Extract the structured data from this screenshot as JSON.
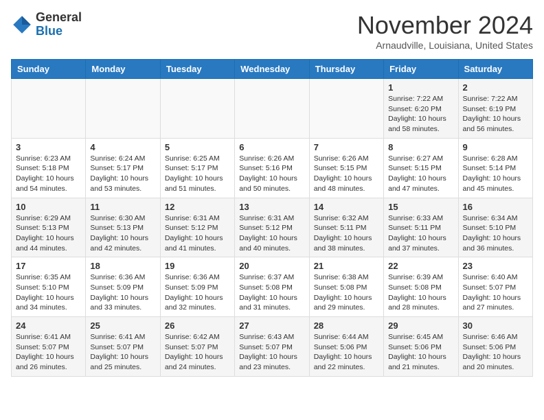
{
  "logo": {
    "general": "General",
    "blue": "Blue"
  },
  "header": {
    "month": "November 2024",
    "location": "Arnaudville, Louisiana, United States"
  },
  "weekdays": [
    "Sunday",
    "Monday",
    "Tuesday",
    "Wednesday",
    "Thursday",
    "Friday",
    "Saturday"
  ],
  "weeks": [
    [
      {
        "day": "",
        "info": ""
      },
      {
        "day": "",
        "info": ""
      },
      {
        "day": "",
        "info": ""
      },
      {
        "day": "",
        "info": ""
      },
      {
        "day": "",
        "info": ""
      },
      {
        "day": "1",
        "info": "Sunrise: 7:22 AM\nSunset: 6:20 PM\nDaylight: 10 hours and 58 minutes."
      },
      {
        "day": "2",
        "info": "Sunrise: 7:22 AM\nSunset: 6:19 PM\nDaylight: 10 hours and 56 minutes."
      }
    ],
    [
      {
        "day": "3",
        "info": "Sunrise: 6:23 AM\nSunset: 5:18 PM\nDaylight: 10 hours and 54 minutes."
      },
      {
        "day": "4",
        "info": "Sunrise: 6:24 AM\nSunset: 5:17 PM\nDaylight: 10 hours and 53 minutes."
      },
      {
        "day": "5",
        "info": "Sunrise: 6:25 AM\nSunset: 5:17 PM\nDaylight: 10 hours and 51 minutes."
      },
      {
        "day": "6",
        "info": "Sunrise: 6:26 AM\nSunset: 5:16 PM\nDaylight: 10 hours and 50 minutes."
      },
      {
        "day": "7",
        "info": "Sunrise: 6:26 AM\nSunset: 5:15 PM\nDaylight: 10 hours and 48 minutes."
      },
      {
        "day": "8",
        "info": "Sunrise: 6:27 AM\nSunset: 5:15 PM\nDaylight: 10 hours and 47 minutes."
      },
      {
        "day": "9",
        "info": "Sunrise: 6:28 AM\nSunset: 5:14 PM\nDaylight: 10 hours and 45 minutes."
      }
    ],
    [
      {
        "day": "10",
        "info": "Sunrise: 6:29 AM\nSunset: 5:13 PM\nDaylight: 10 hours and 44 minutes."
      },
      {
        "day": "11",
        "info": "Sunrise: 6:30 AM\nSunset: 5:13 PM\nDaylight: 10 hours and 42 minutes."
      },
      {
        "day": "12",
        "info": "Sunrise: 6:31 AM\nSunset: 5:12 PM\nDaylight: 10 hours and 41 minutes."
      },
      {
        "day": "13",
        "info": "Sunrise: 6:31 AM\nSunset: 5:12 PM\nDaylight: 10 hours and 40 minutes."
      },
      {
        "day": "14",
        "info": "Sunrise: 6:32 AM\nSunset: 5:11 PM\nDaylight: 10 hours and 38 minutes."
      },
      {
        "day": "15",
        "info": "Sunrise: 6:33 AM\nSunset: 5:11 PM\nDaylight: 10 hours and 37 minutes."
      },
      {
        "day": "16",
        "info": "Sunrise: 6:34 AM\nSunset: 5:10 PM\nDaylight: 10 hours and 36 minutes."
      }
    ],
    [
      {
        "day": "17",
        "info": "Sunrise: 6:35 AM\nSunset: 5:10 PM\nDaylight: 10 hours and 34 minutes."
      },
      {
        "day": "18",
        "info": "Sunrise: 6:36 AM\nSunset: 5:09 PM\nDaylight: 10 hours and 33 minutes."
      },
      {
        "day": "19",
        "info": "Sunrise: 6:36 AM\nSunset: 5:09 PM\nDaylight: 10 hours and 32 minutes."
      },
      {
        "day": "20",
        "info": "Sunrise: 6:37 AM\nSunset: 5:08 PM\nDaylight: 10 hours and 31 minutes."
      },
      {
        "day": "21",
        "info": "Sunrise: 6:38 AM\nSunset: 5:08 PM\nDaylight: 10 hours and 29 minutes."
      },
      {
        "day": "22",
        "info": "Sunrise: 6:39 AM\nSunset: 5:08 PM\nDaylight: 10 hours and 28 minutes."
      },
      {
        "day": "23",
        "info": "Sunrise: 6:40 AM\nSunset: 5:07 PM\nDaylight: 10 hours and 27 minutes."
      }
    ],
    [
      {
        "day": "24",
        "info": "Sunrise: 6:41 AM\nSunset: 5:07 PM\nDaylight: 10 hours and 26 minutes."
      },
      {
        "day": "25",
        "info": "Sunrise: 6:41 AM\nSunset: 5:07 PM\nDaylight: 10 hours and 25 minutes."
      },
      {
        "day": "26",
        "info": "Sunrise: 6:42 AM\nSunset: 5:07 PM\nDaylight: 10 hours and 24 minutes."
      },
      {
        "day": "27",
        "info": "Sunrise: 6:43 AM\nSunset: 5:07 PM\nDaylight: 10 hours and 23 minutes."
      },
      {
        "day": "28",
        "info": "Sunrise: 6:44 AM\nSunset: 5:06 PM\nDaylight: 10 hours and 22 minutes."
      },
      {
        "day": "29",
        "info": "Sunrise: 6:45 AM\nSunset: 5:06 PM\nDaylight: 10 hours and 21 minutes."
      },
      {
        "day": "30",
        "info": "Sunrise: 6:46 AM\nSunset: 5:06 PM\nDaylight: 10 hours and 20 minutes."
      }
    ]
  ]
}
